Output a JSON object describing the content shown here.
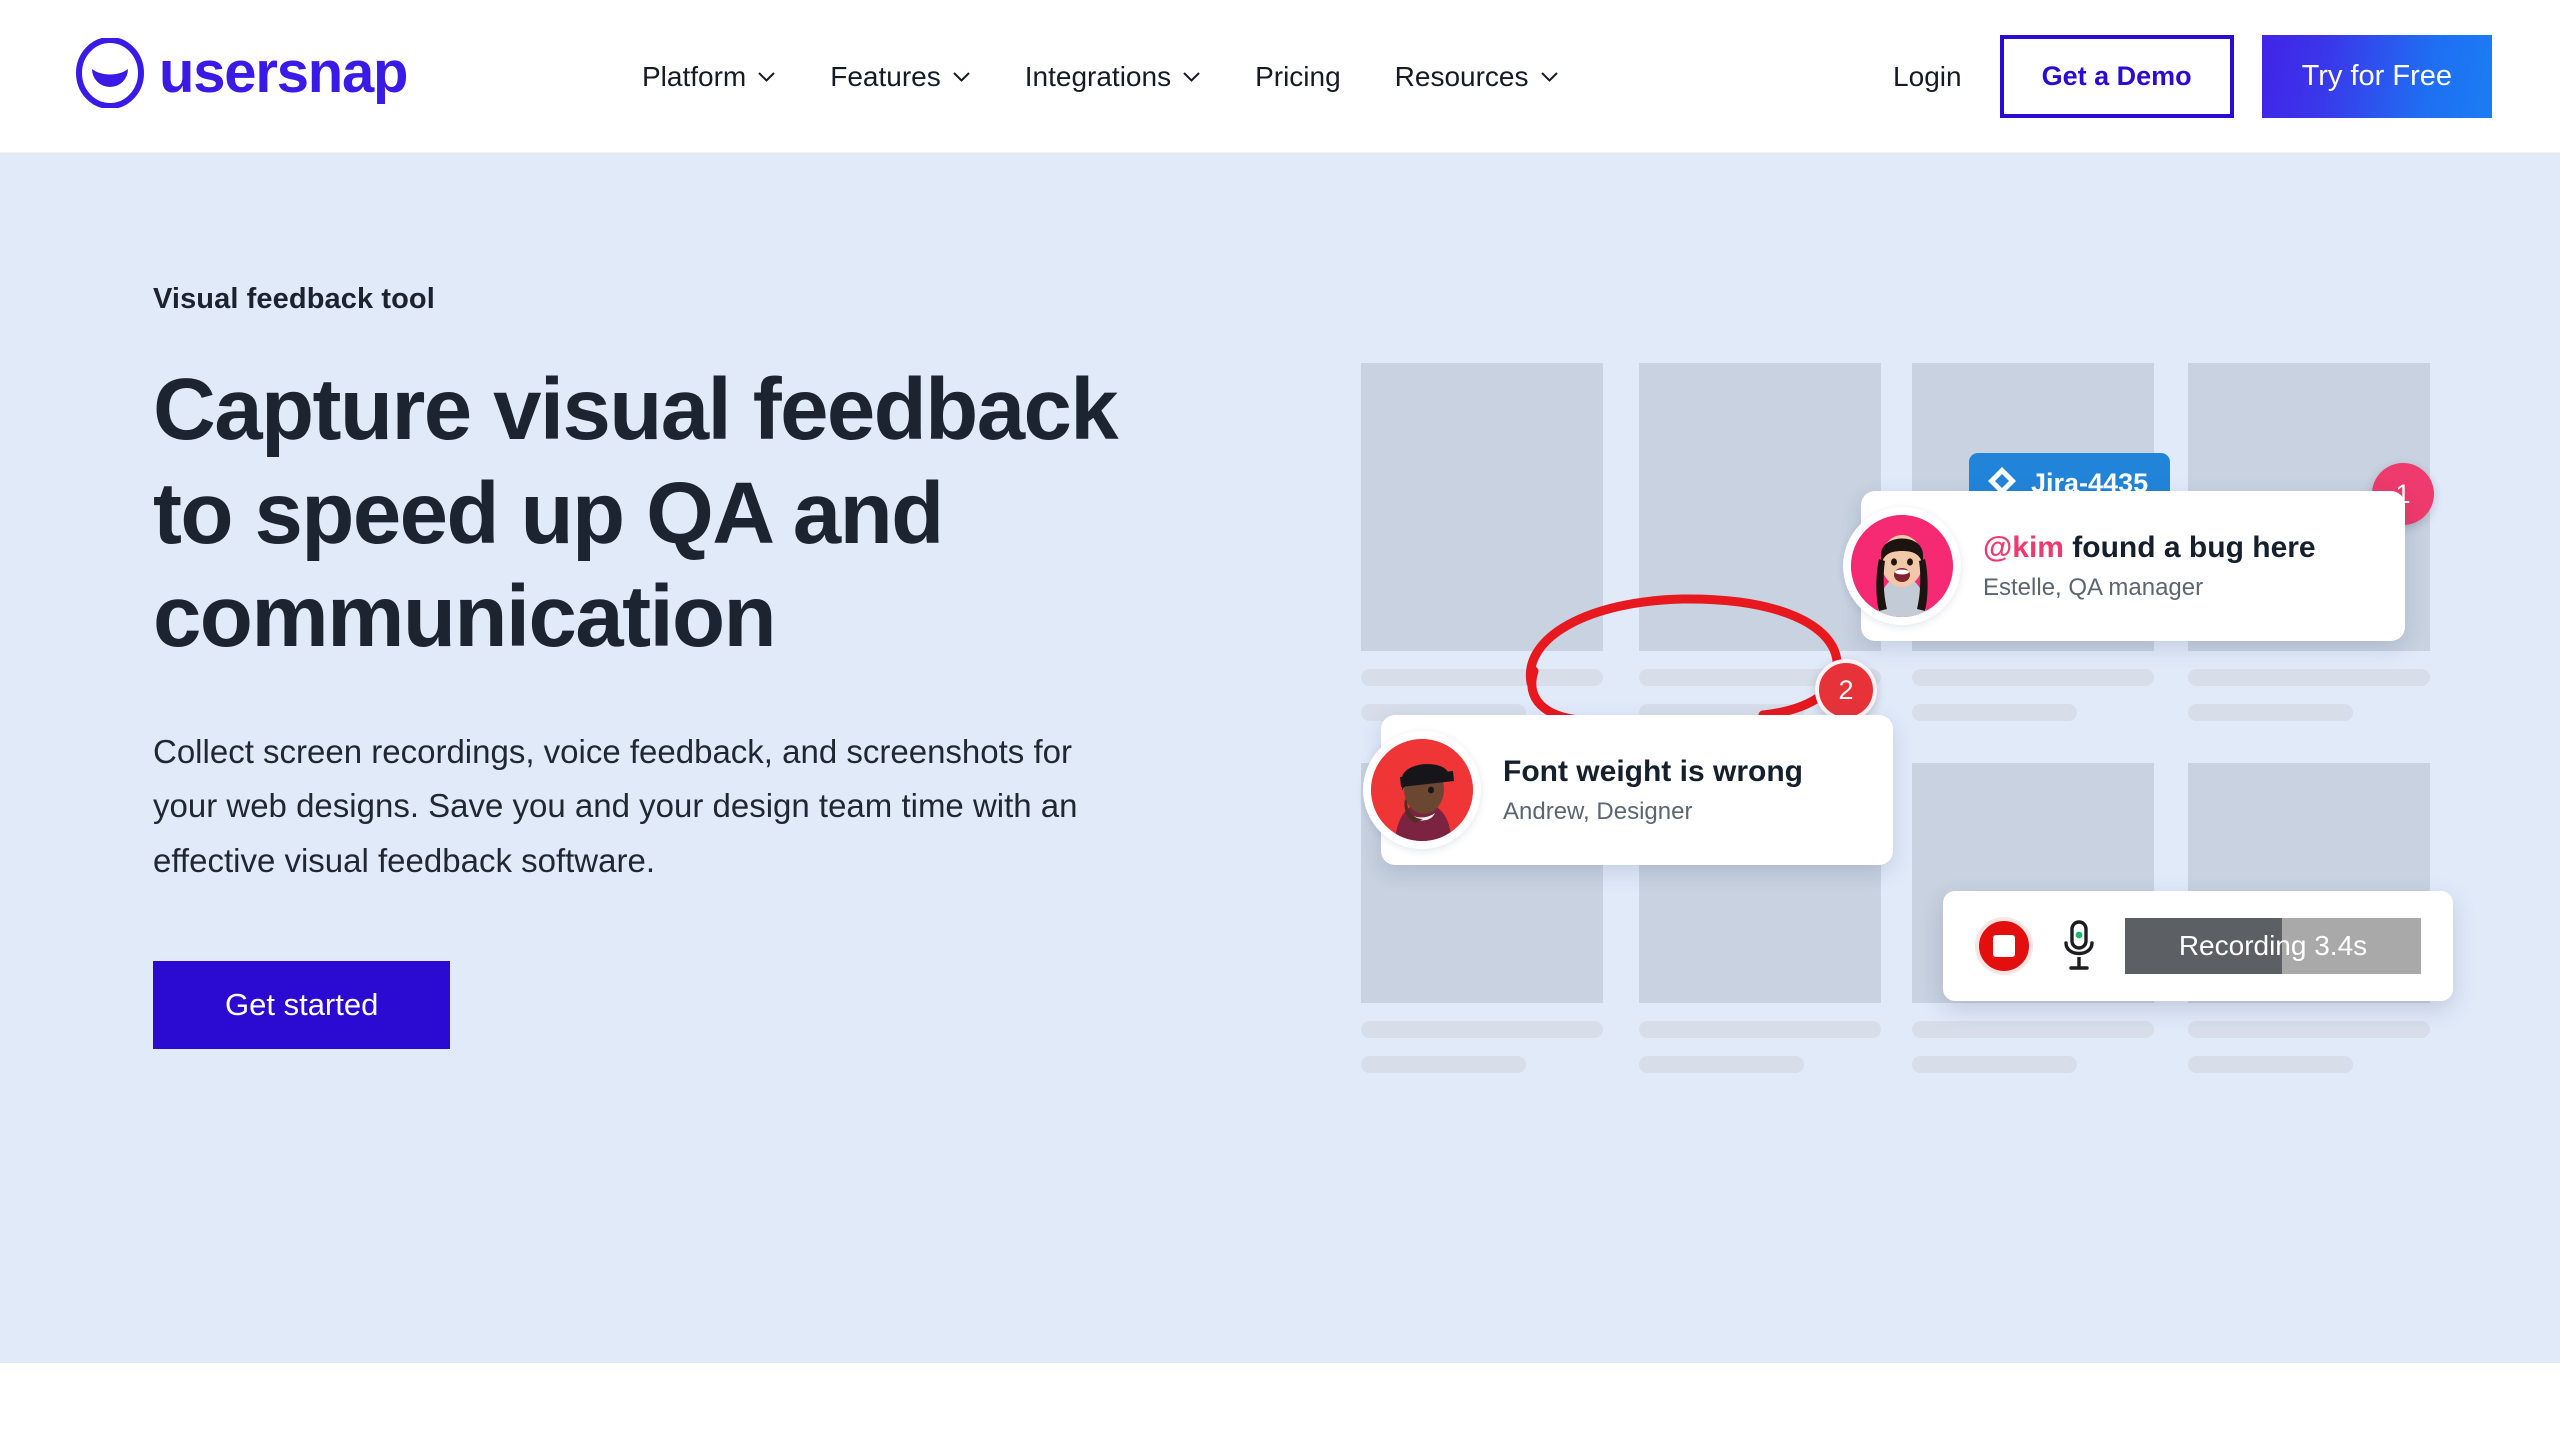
{
  "brand": {
    "name": "usersnap",
    "logo_icon": "smiley-circle-icon",
    "color": "#3a1ae6"
  },
  "header": {
    "nav_items": [
      {
        "label": "Platform",
        "has_dropdown": true,
        "icon": "chevron-down-icon"
      },
      {
        "label": "Features",
        "has_dropdown": true,
        "icon": "chevron-down-icon"
      },
      {
        "label": "Integrations",
        "has_dropdown": true,
        "icon": "chevron-down-icon"
      },
      {
        "label": "Pricing",
        "has_dropdown": false
      },
      {
        "label": "Resources",
        "has_dropdown": true,
        "icon": "chevron-down-icon"
      }
    ],
    "login_label": "Login",
    "demo_label": "Get a Demo",
    "try_label": "Try for Free",
    "demo_border_color": "#2b0bd1",
    "try_gradient_from": "#4223e8",
    "try_gradient_to": "#1a7df5"
  },
  "hero": {
    "eyebrow": "Visual feedback tool",
    "headline": "Capture visual feedback to speed up QA and communication",
    "subcopy": "Collect screen recordings, voice feedback, and screenshots for your web designs. Save you and your design team time with an effective visual feedback software.",
    "cta_label": "Get started",
    "cta_color": "#2b0bd1",
    "background_color": "#e1eaf9"
  },
  "illustration": {
    "wireframe_color": "#c8d2e0",
    "wireframe_line_color": "#d7deea",
    "annotation_color": "#e8181f",
    "jira_badge": {
      "label": "Jira-4435",
      "icon": "jira-diamond-icon",
      "color": "#2284d9"
    },
    "comment_cards": [
      {
        "pin": "1",
        "pin_color": "#ee3a6c",
        "mention": "@kim",
        "title_rest": " found a bug here",
        "author": "Estelle, QA manager",
        "avatar": "avatar-estelle"
      },
      {
        "pin": "2",
        "pin_color": "#e8323a",
        "title": "Font weight is wrong",
        "author": "Andrew, Designer",
        "avatar": "avatar-andrew"
      }
    ],
    "recorder": {
      "stop_icon": "stop-record-icon",
      "mic_icon": "microphone-icon",
      "status_text": "Recording 3.4s",
      "progress_percent": 53,
      "fill_color": "#5c5f63",
      "track_color": "#a9a9a9"
    }
  }
}
